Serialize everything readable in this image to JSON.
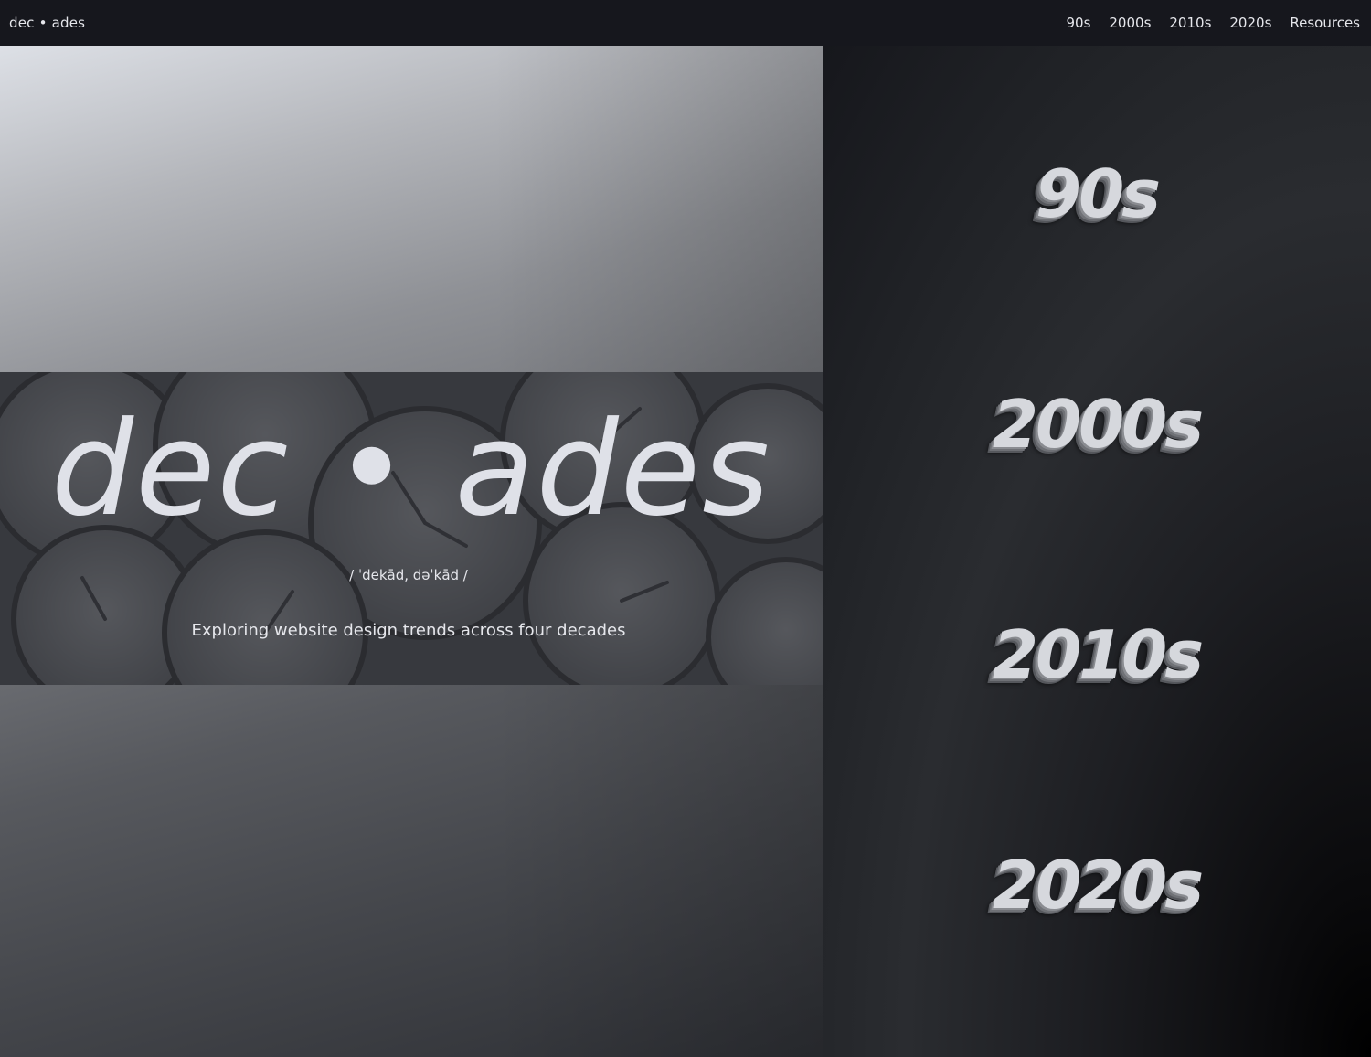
{
  "navbar": {
    "brand": "dec • ades",
    "links": [
      "90s",
      "2000s",
      "2010s",
      "2020s",
      "Resources"
    ]
  },
  "hero": {
    "title": "dec • ades",
    "pronunciation": "/ ˈdekād, dəˈkād /",
    "tagline": "Exploring website design trends across four decades"
  },
  "decades": [
    "90s",
    "2000s",
    "2010s",
    "2020s"
  ],
  "colors": {
    "navbar_bg": "#16171d",
    "text": "#e6e7ec",
    "hero_title": "#dfe1e8"
  }
}
